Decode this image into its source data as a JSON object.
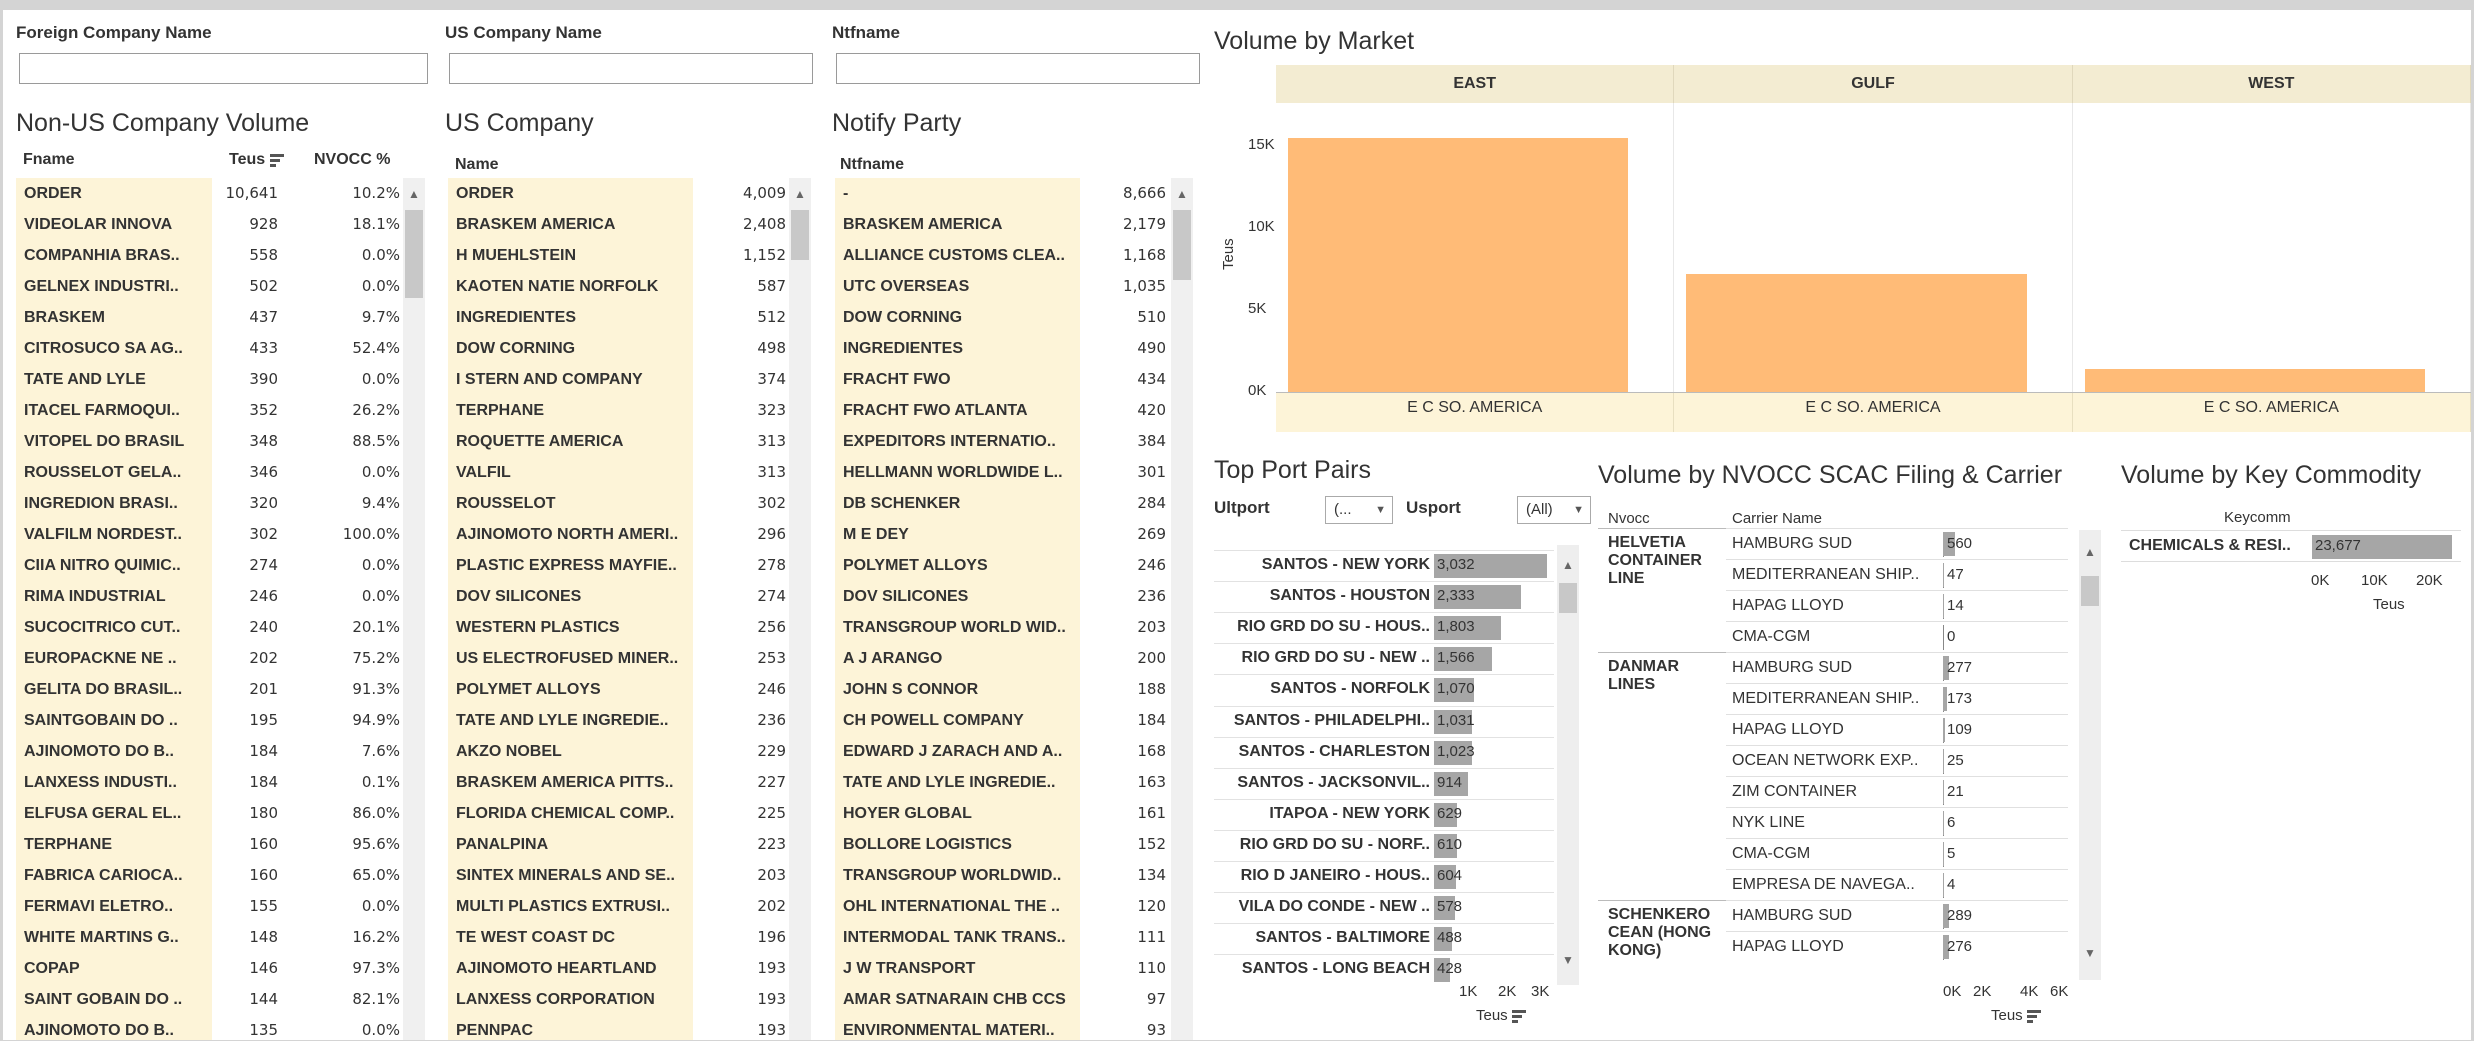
{
  "filters": [
    {
      "label": "Foreign Company Name",
      "value": ""
    },
    {
      "label": "US Company Name",
      "value": ""
    },
    {
      "label": "Ntfname",
      "value": ""
    }
  ],
  "nonus": {
    "title": "Non-US Company Volume",
    "col_name": "Fname",
    "col_teus": "Teus",
    "col_pct": "NVOCC %",
    "rows": [
      [
        "ORDER",
        "10,641",
        "10.2%"
      ],
      [
        "VIDEOLAR INNOVA",
        "928",
        "18.1%"
      ],
      [
        "COMPANHIA BRAS..",
        "558",
        "0.0%"
      ],
      [
        "GELNEX INDUSTRI..",
        "502",
        "0.0%"
      ],
      [
        "BRASKEM",
        "437",
        "9.7%"
      ],
      [
        "CITROSUCO SA AG..",
        "433",
        "52.4%"
      ],
      [
        "TATE AND LYLE",
        "390",
        "0.0%"
      ],
      [
        "ITACEL FARMOQUI..",
        "352",
        "26.2%"
      ],
      [
        "VITOPEL DO BRASIL",
        "348",
        "88.5%"
      ],
      [
        "ROUSSELOT GELA..",
        "346",
        "0.0%"
      ],
      [
        "INGREDION BRASI..",
        "320",
        "9.4%"
      ],
      [
        "VALFILM NORDEST..",
        "302",
        "100.0%"
      ],
      [
        "CIIA NITRO QUIMIC..",
        "274",
        "0.0%"
      ],
      [
        "RIMA INDUSTRIAL",
        "246",
        "0.0%"
      ],
      [
        "SUCOCITRICO CUT..",
        "240",
        "20.1%"
      ],
      [
        "EUROPACKNE NE ..",
        "202",
        "75.2%"
      ],
      [
        "GELITA DO BRASIL..",
        "201",
        "91.3%"
      ],
      [
        "SAINTGOBAIN DO ..",
        "195",
        "94.9%"
      ],
      [
        "AJINOMOTO DO B..",
        "184",
        "7.6%"
      ],
      [
        "LANXESS INDUSTI..",
        "184",
        "0.1%"
      ],
      [
        "ELFUSA GERAL EL..",
        "180",
        "86.0%"
      ],
      [
        "TERPHANE",
        "160",
        "95.6%"
      ],
      [
        "FABRICA CARIOCA..",
        "160",
        "65.0%"
      ],
      [
        "FERMAVI ELETRO..",
        "155",
        "0.0%"
      ],
      [
        "WHITE MARTINS G..",
        "148",
        "16.2%"
      ],
      [
        "COPAP",
        "146",
        "97.3%"
      ],
      [
        "SAINT GOBAIN DO ..",
        "144",
        "82.1%"
      ],
      [
        "AJINOMOTO DO B..",
        "135",
        "0.0%"
      ]
    ]
  },
  "us": {
    "title": "US Company",
    "col_name": "Name",
    "rows": [
      [
        "ORDER",
        "4,009"
      ],
      [
        "BRASKEM AMERICA",
        "2,408"
      ],
      [
        "H MUEHLSTEIN",
        "1,152"
      ],
      [
        "KAOTEN NATIE NORFOLK",
        "587"
      ],
      [
        "INGREDIENTES",
        "512"
      ],
      [
        "DOW CORNING",
        "498"
      ],
      [
        "I STERN AND COMPANY",
        "374"
      ],
      [
        "TERPHANE",
        "323"
      ],
      [
        "ROQUETTE AMERICA",
        "313"
      ],
      [
        "VALFIL",
        "313"
      ],
      [
        "ROUSSELOT",
        "302"
      ],
      [
        "AJINOMOTO NORTH AMERI..",
        "296"
      ],
      [
        "PLASTIC EXPRESS MAYFIE..",
        "278"
      ],
      [
        "DOV SILICONES",
        "274"
      ],
      [
        "WESTERN PLASTICS",
        "256"
      ],
      [
        "US ELECTROFUSED MINER..",
        "253"
      ],
      [
        "POLYMET ALLOYS",
        "246"
      ],
      [
        "TATE AND LYLE INGREDIE..",
        "236"
      ],
      [
        "AKZO NOBEL",
        "229"
      ],
      [
        "BRASKEM AMERICA PITTS..",
        "227"
      ],
      [
        "FLORIDA CHEMICAL COMP..",
        "225"
      ],
      [
        "PANALPINA",
        "223"
      ],
      [
        "SINTEX MINERALS AND SE..",
        "203"
      ],
      [
        "MULTI PLASTICS EXTRUSI..",
        "202"
      ],
      [
        "TE WEST COAST DC",
        "196"
      ],
      [
        "AJINOMOTO HEARTLAND",
        "193"
      ],
      [
        "LANXESS CORPORATION",
        "193"
      ],
      [
        "PENNPAC",
        "193"
      ]
    ]
  },
  "notify": {
    "title": "Notify Party",
    "col_name": "Ntfname",
    "rows": [
      [
        "-",
        "8,666"
      ],
      [
        "BRASKEM AMERICA",
        "2,179"
      ],
      [
        "ALLIANCE CUSTOMS CLEA..",
        "1,168"
      ],
      [
        "UTC OVERSEAS",
        "1,035"
      ],
      [
        "DOW CORNING",
        "510"
      ],
      [
        "INGREDIENTES",
        "490"
      ],
      [
        "FRACHT FWO",
        "434"
      ],
      [
        "FRACHT FWO ATLANTA",
        "420"
      ],
      [
        "EXPEDITORS INTERNATIO..",
        "384"
      ],
      [
        "HELLMANN WORLDWIDE L..",
        "301"
      ],
      [
        "DB SCHENKER",
        "284"
      ],
      [
        "M E DEY",
        "269"
      ],
      [
        "POLYMET ALLOYS",
        "246"
      ],
      [
        "DOV SILICONES",
        "236"
      ],
      [
        "TRANSGROUP WORLD WID..",
        "203"
      ],
      [
        "A J ARANGO",
        "200"
      ],
      [
        "JOHN S CONNOR",
        "188"
      ],
      [
        "CH POWELL COMPANY",
        "184"
      ],
      [
        "EDWARD J ZARACH AND A..",
        "168"
      ],
      [
        "TATE AND LYLE INGREDIE..",
        "163"
      ],
      [
        "HOYER GLOBAL",
        "161"
      ],
      [
        "BOLLORE LOGISTICS",
        "152"
      ],
      [
        "TRANSGROUP WORLDWID..",
        "134"
      ],
      [
        "OHL INTERNATIONAL THE ..",
        "120"
      ],
      [
        "INTERMODAL TANK TRANS..",
        "111"
      ],
      [
        "J W TRANSPORT",
        "110"
      ],
      [
        "AMAR SATNARAIN CHB CCS",
        "97"
      ],
      [
        "ENVIRONMENTAL MATERI..",
        "93"
      ]
    ]
  },
  "market": {
    "title": "Volume by Market",
    "ylabel": "Teus",
    "yticks": [
      "15K",
      "10K",
      "5K",
      "0K"
    ]
  },
  "chart_data": {
    "type": "bar",
    "title": "Volume by Market",
    "ylabel": "Teus",
    "ylim": [
      0,
      17000
    ],
    "grid": false,
    "panels": [
      "EAST",
      "GULF",
      "WEST"
    ],
    "categories": [
      "E C SO. AMERICA",
      "E C SO. AMERICA",
      "E C SO. AMERICA"
    ],
    "values": [
      15500,
      7200,
      1400
    ],
    "bar_color": "#ffbb77"
  },
  "ports": {
    "title": "Top Port Pairs",
    "ultport_label": "Ultport",
    "ultport_value": "(...",
    "usport_label": "Usport",
    "usport_value": "(All)",
    "axis_ticks": [
      "1K",
      "2K",
      "3K"
    ],
    "axis_label": "Teus",
    "rows": [
      {
        "label": "SANTOS - NEW YORK",
        "value": 3032,
        "text": "3,032"
      },
      {
        "label": "SANTOS - HOUSTON",
        "value": 2333,
        "text": "2,333"
      },
      {
        "label": "RIO GRD DO SU - HOUS..",
        "value": 1803,
        "text": "1,803"
      },
      {
        "label": "RIO GRD DO SU - NEW ..",
        "value": 1566,
        "text": "1,566"
      },
      {
        "label": "SANTOS - NORFOLK",
        "value": 1070,
        "text": "1,070"
      },
      {
        "label": "SANTOS - PHILADELPHI..",
        "value": 1031,
        "text": "1,031"
      },
      {
        "label": "SANTOS - CHARLESTON",
        "value": 1023,
        "text": "1,023"
      },
      {
        "label": "SANTOS - JACKSONVIL..",
        "value": 914,
        "text": "914"
      },
      {
        "label": "ITAPOA - NEW YORK",
        "value": 629,
        "text": "629"
      },
      {
        "label": "RIO GRD DO SU - NORF..",
        "value": 610,
        "text": "610"
      },
      {
        "label": "RIO D JANEIRO - HOUS..",
        "value": 604,
        "text": "604"
      },
      {
        "label": "VILA DO CONDE - NEW ..",
        "value": 578,
        "text": "578"
      },
      {
        "label": "SANTOS - BALTIMORE",
        "value": 488,
        "text": "488"
      },
      {
        "label": "SANTOS - LONG BEACH",
        "value": 428,
        "text": "428"
      }
    ]
  },
  "nvocc": {
    "title": "Volume by NVOCC SCAC Filing & Carrier",
    "col_nvocc": "Nvocc",
    "col_carrier": "Carrier Name",
    "axis_ticks": [
      "0K",
      "2K",
      "4K",
      "6K"
    ],
    "axis_label": "Teus",
    "groups": [
      {
        "name": "HELVETIA CONTAINER LINE",
        "rows": [
          [
            "HAMBURG SUD",
            "560",
            560
          ],
          [
            "MEDITERRANEAN SHIP..",
            "47",
            47
          ],
          [
            "HAPAG LLOYD",
            "14",
            14
          ],
          [
            "CMA-CGM",
            "0",
            0
          ]
        ]
      },
      {
        "name": "DANMAR LINES",
        "rows": [
          [
            "HAMBURG SUD",
            "277",
            277
          ],
          [
            "MEDITERRANEAN SHIP..",
            "173",
            173
          ],
          [
            "HAPAG LLOYD",
            "109",
            109
          ],
          [
            "OCEAN NETWORK EXP..",
            "25",
            25
          ],
          [
            "ZIM CONTAINER",
            "21",
            21
          ],
          [
            "NYK LINE",
            "6",
            6
          ],
          [
            "CMA-CGM",
            "5",
            5
          ],
          [
            "EMPRESA DE NAVEGA..",
            "4",
            4
          ]
        ]
      },
      {
        "name": "SCHENKERO CEAN (HONG KONG)",
        "rows": [
          [
            "HAMBURG SUD",
            "289",
            289
          ],
          [
            "HAPAG LLOYD",
            "276",
            276
          ]
        ]
      }
    ]
  },
  "commodity": {
    "title": "Volume by Key Commodity",
    "col": "Keycomm",
    "row_label": "CHEMICALS & RESI..",
    "value": 23677,
    "value_text": "23,677",
    "axis_ticks": [
      "0K",
      "10K",
      "20K"
    ],
    "axis_label": "Teus"
  }
}
